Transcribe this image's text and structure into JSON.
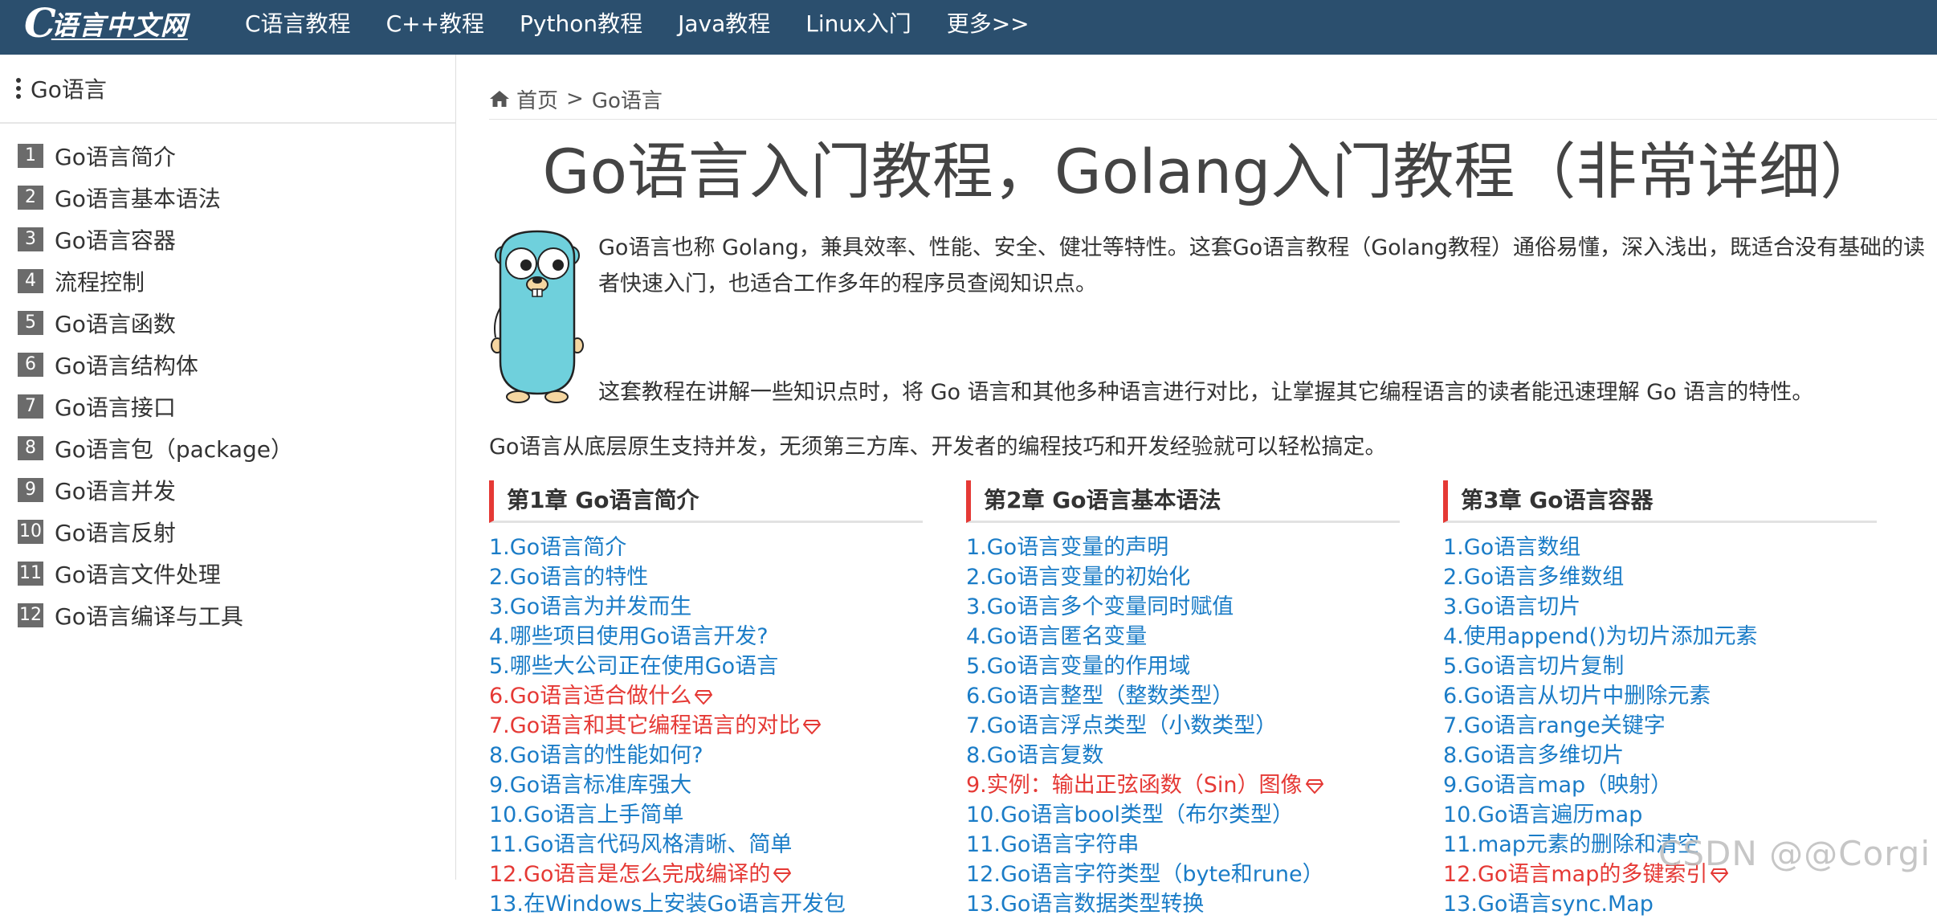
{
  "topbar": {
    "logo_text": "语言中文网",
    "nav": [
      "C语言教程",
      "C++教程",
      "Python教程",
      "Java教程",
      "Linux入门",
      "更多>>"
    ]
  },
  "sidebar": {
    "title": "Go语言",
    "items": [
      {
        "num": "1",
        "label": "Go语言简介"
      },
      {
        "num": "2",
        "label": "Go语言基本语法"
      },
      {
        "num": "3",
        "label": "Go语言容器"
      },
      {
        "num": "4",
        "label": "流程控制"
      },
      {
        "num": "5",
        "label": "Go语言函数"
      },
      {
        "num": "6",
        "label": "Go语言结构体"
      },
      {
        "num": "7",
        "label": "Go语言接口"
      },
      {
        "num": "8",
        "label": "Go语言包（package）"
      },
      {
        "num": "9",
        "label": "Go语言并发"
      },
      {
        "num": "10",
        "label": "Go语言反射"
      },
      {
        "num": "11",
        "label": "Go语言文件处理"
      },
      {
        "num": "12",
        "label": "Go语言编译与工具"
      }
    ]
  },
  "breadcrumb": {
    "home": "首页",
    "sep": ">",
    "current": "Go语言"
  },
  "main": {
    "title": "Go语言入门教程，Golang入门教程（非常详细）",
    "intro1": "Go语言也称 Golang，兼具效率、性能、安全、健壮等特性。这套Go语言教程（Golang教程）通俗易懂，深入浅出，既适合没有基础的读者快速入门，也适合工作多年的程序员查阅知识点。",
    "intro2": "这套教程在讲解一些知识点时，将 Go 语言和其他多种语言进行对比，让掌握其它编程语言的读者能迅速理解 Go 语言的特性。",
    "intro3": "Go语言从底层原生支持并发，无须第三方库、开发者的编程技巧和开发经验就可以轻松搞定。"
  },
  "chapters": [
    {
      "title": "第1章 Go语言简介",
      "links": [
        {
          "text": "1.Go语言简介",
          "hot": false
        },
        {
          "text": "2.Go语言的特性",
          "hot": false
        },
        {
          "text": "3.Go语言为并发而生",
          "hot": false
        },
        {
          "text": "4.哪些项目使用Go语言开发?",
          "hot": false
        },
        {
          "text": "5.哪些大公司正在使用Go语言",
          "hot": false
        },
        {
          "text": "6.Go语言适合做什么",
          "hot": true
        },
        {
          "text": "7.Go语言和其它编程语言的对比",
          "hot": true
        },
        {
          "text": "8.Go语言的性能如何?",
          "hot": false
        },
        {
          "text": "9.Go语言标准库强大",
          "hot": false
        },
        {
          "text": "10.Go语言上手简单",
          "hot": false
        },
        {
          "text": "11.Go语言代码风格清晰、简单",
          "hot": false
        },
        {
          "text": "12.Go语言是怎么完成编译的",
          "hot": true
        },
        {
          "text": "13.在Windows上安装Go语言开发包",
          "hot": false
        }
      ]
    },
    {
      "title": "第2章 Go语言基本语法",
      "links": [
        {
          "text": "1.Go语言变量的声明",
          "hot": false
        },
        {
          "text": "2.Go语言变量的初始化",
          "hot": false
        },
        {
          "text": "3.Go语言多个变量同时赋值",
          "hot": false
        },
        {
          "text": "4.Go语言匿名变量",
          "hot": false
        },
        {
          "text": "5.Go语言变量的作用域",
          "hot": false
        },
        {
          "text": "6.Go语言整型（整数类型）",
          "hot": false
        },
        {
          "text": "7.Go语言浮点类型（小数类型）",
          "hot": false
        },
        {
          "text": "8.Go语言复数",
          "hot": false
        },
        {
          "text": "9.实例：输出正弦函数（Sin）图像",
          "hot": true
        },
        {
          "text": "10.Go语言bool类型（布尔类型）",
          "hot": false
        },
        {
          "text": "11.Go语言字符串",
          "hot": false
        },
        {
          "text": "12.Go语言字符类型（byte和rune）",
          "hot": false
        },
        {
          "text": "13.Go语言数据类型转换",
          "hot": false
        }
      ]
    },
    {
      "title": "第3章 Go语言容器",
      "links": [
        {
          "text": "1.Go语言数组",
          "hot": false
        },
        {
          "text": "2.Go语言多维数组",
          "hot": false
        },
        {
          "text": "3.Go语言切片",
          "hot": false
        },
        {
          "text": "4.使用append()为切片添加元素",
          "hot": false
        },
        {
          "text": "5.Go语言切片复制",
          "hot": false
        },
        {
          "text": "6.Go语言从切片中删除元素",
          "hot": false
        },
        {
          "text": "7.Go语言range关键字",
          "hot": false
        },
        {
          "text": "8.Go语言多维切片",
          "hot": false
        },
        {
          "text": "9.Go语言map（映射）",
          "hot": false
        },
        {
          "text": "10.Go语言遍历map",
          "hot": false
        },
        {
          "text": "11.map元素的删除和清空",
          "hot": false
        },
        {
          "text": "12.Go语言map的多键索引",
          "hot": true
        },
        {
          "text": "13.Go语言sync.Map",
          "hot": false
        }
      ]
    }
  ],
  "watermark": "CSDN @@Corgi",
  "colors": {
    "topbar": "#2b4f6e",
    "link": "#1a7cc7",
    "hot": "#e53935",
    "accent": "#e53935"
  }
}
